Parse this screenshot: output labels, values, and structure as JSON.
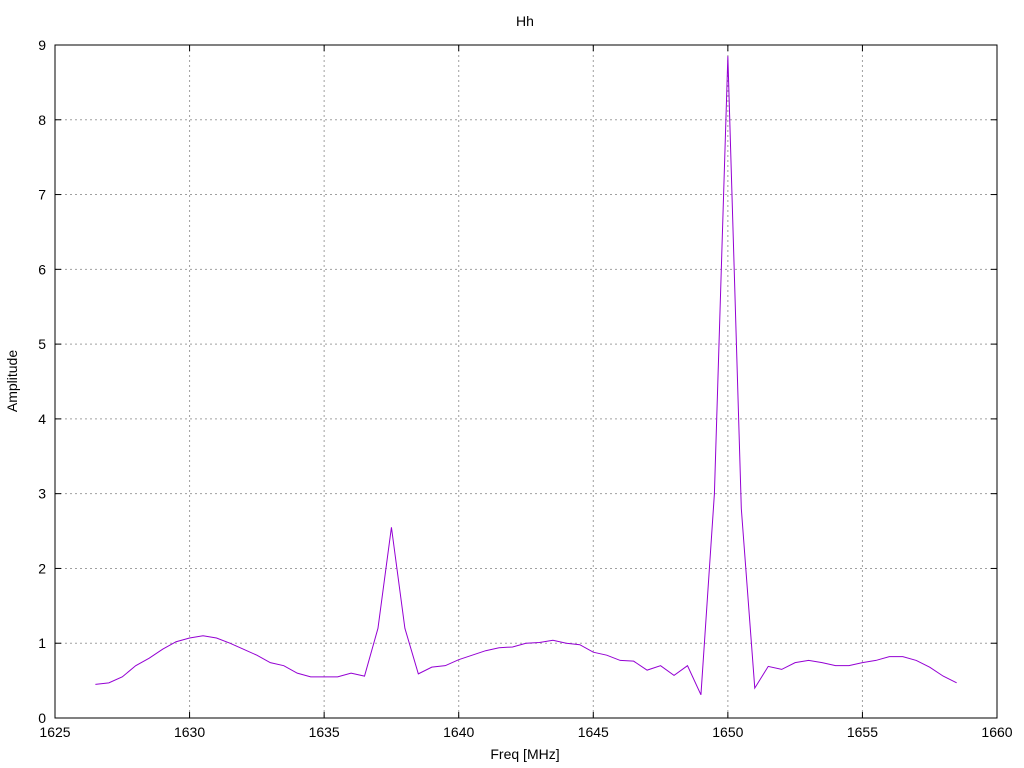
{
  "chart_data": {
    "type": "line",
    "title": "Hh",
    "xlabel": "Freq [MHz]",
    "ylabel": "Amplitude",
    "xlim": [
      1625,
      1660
    ],
    "ylim": [
      0,
      9
    ],
    "xticks": [
      1625,
      1630,
      1635,
      1640,
      1645,
      1650,
      1655,
      1660
    ],
    "yticks": [
      0,
      1,
      2,
      3,
      4,
      5,
      6,
      7,
      8,
      9
    ],
    "grid": true,
    "legend": "none",
    "series": [
      {
        "color": "#9400d3",
        "points": [
          [
            1626.5,
            0.45
          ],
          [
            1627.0,
            0.47
          ],
          [
            1627.5,
            0.55
          ],
          [
            1628.0,
            0.7
          ],
          [
            1628.5,
            0.8
          ],
          [
            1629.0,
            0.92
          ],
          [
            1629.5,
            1.02
          ],
          [
            1630.0,
            1.07
          ],
          [
            1630.5,
            1.1
          ],
          [
            1631.0,
            1.07
          ],
          [
            1631.5,
            1.0
          ],
          [
            1632.0,
            0.92
          ],
          [
            1632.5,
            0.84
          ],
          [
            1633.0,
            0.74
          ],
          [
            1633.5,
            0.7
          ],
          [
            1634.0,
            0.6
          ],
          [
            1634.5,
            0.55
          ],
          [
            1635.0,
            0.55
          ],
          [
            1635.5,
            0.55
          ],
          [
            1636.0,
            0.6
          ],
          [
            1636.5,
            0.56
          ],
          [
            1637.0,
            1.2
          ],
          [
            1637.5,
            2.55
          ],
          [
            1638.0,
            1.2
          ],
          [
            1638.5,
            0.59
          ],
          [
            1639.0,
            0.68
          ],
          [
            1639.5,
            0.7
          ],
          [
            1640.0,
            0.78
          ],
          [
            1640.5,
            0.84
          ],
          [
            1641.0,
            0.9
          ],
          [
            1641.5,
            0.94
          ],
          [
            1642.0,
            0.95
          ],
          [
            1642.5,
            1.0
          ],
          [
            1643.0,
            1.01
          ],
          [
            1643.5,
            1.04
          ],
          [
            1644.0,
            1.0
          ],
          [
            1644.5,
            0.98
          ],
          [
            1645.0,
            0.88
          ],
          [
            1645.5,
            0.84
          ],
          [
            1646.0,
            0.77
          ],
          [
            1646.5,
            0.76
          ],
          [
            1647.0,
            0.64
          ],
          [
            1647.5,
            0.7
          ],
          [
            1648.0,
            0.57
          ],
          [
            1648.5,
            0.7
          ],
          [
            1649.0,
            0.31
          ],
          [
            1649.5,
            3.0
          ],
          [
            1650.0,
            8.85
          ],
          [
            1650.5,
            2.8
          ],
          [
            1651.0,
            0.4
          ],
          [
            1651.5,
            0.69
          ],
          [
            1652.0,
            0.65
          ],
          [
            1652.5,
            0.74
          ],
          [
            1653.0,
            0.77
          ],
          [
            1653.5,
            0.74
          ],
          [
            1654.0,
            0.7
          ],
          [
            1654.5,
            0.7
          ],
          [
            1655.0,
            0.74
          ],
          [
            1655.5,
            0.77
          ],
          [
            1656.0,
            0.82
          ],
          [
            1656.5,
            0.82
          ],
          [
            1657.0,
            0.77
          ],
          [
            1657.5,
            0.68
          ],
          [
            1658.0,
            0.56
          ],
          [
            1658.5,
            0.47
          ]
        ]
      }
    ]
  }
}
